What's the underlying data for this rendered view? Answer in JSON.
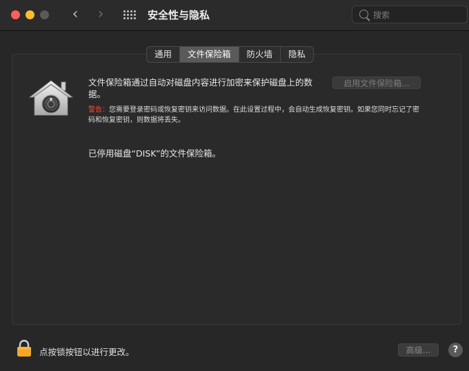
{
  "window": {
    "title": "安全性与隐私",
    "search_placeholder": "搜索"
  },
  "tabs": [
    {
      "label": "通用",
      "active": false
    },
    {
      "label": "文件保险箱",
      "active": true
    },
    {
      "label": "防火墙",
      "active": false
    },
    {
      "label": "隐私",
      "active": false
    }
  ],
  "filevault": {
    "description": "文件保险箱通过自动对磁盘内容进行加密来保护磁盘上的数据。",
    "enable_button": "启用文件保险箱...",
    "warning_label": "警告：",
    "warning_text": "您需要登录密码或恢复密钥来访问数据。在此设置过程中，会自动生成恢复密钥。如果您同时忘记了密码和恢复密钥，则数据将丢失。",
    "status": "已停用磁盘“DISK”的文件保险箱。"
  },
  "footer": {
    "lock_text": "点按锁按钮以进行更改。",
    "advanced_button": "高级...",
    "help_button": "?"
  },
  "colors": {
    "close": "#ff5f57",
    "minimize": "#febc2e",
    "warning": "#ff4a3d",
    "lock": "#f5a623"
  }
}
